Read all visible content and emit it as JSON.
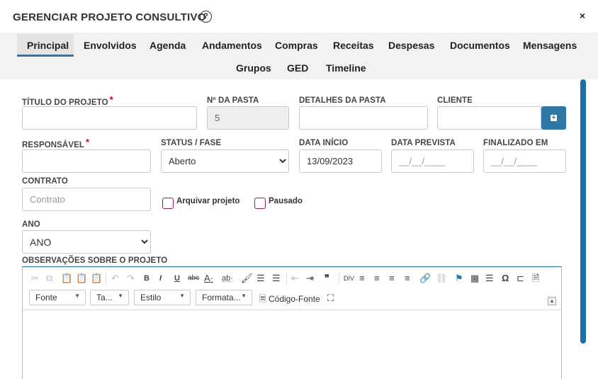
{
  "header": {
    "title": "GERENCIAR PROJETO CONSULTIVO",
    "help_icon": "help-circle-icon",
    "close_label": "×"
  },
  "tabs": [
    {
      "label": "Principal",
      "active": true
    },
    {
      "label": "Envolvidos"
    },
    {
      "label": "Agenda"
    },
    {
      "label": "Andamentos"
    },
    {
      "label": "Compras"
    },
    {
      "label": "Receitas"
    },
    {
      "label": "Despesas"
    },
    {
      "label": "Documentos"
    },
    {
      "label": "Mensagens"
    },
    {
      "label": "Grupos"
    },
    {
      "label": "GED"
    },
    {
      "label": "Timeline"
    }
  ],
  "form": {
    "titulo": {
      "label": "TÍTULO DO PROJETO",
      "required_mark": "*",
      "value": ""
    },
    "n_pasta": {
      "label": "Nº DA PASTA",
      "value": "5"
    },
    "detalhes_pasta": {
      "label": "DETALHES DA PASTA",
      "value": ""
    },
    "cliente": {
      "label": "CLIENTE",
      "value": "",
      "add_icon": "plus-icon"
    },
    "responsavel": {
      "label": "RESPONSÁVEL",
      "required_mark": "*",
      "value": ""
    },
    "status": {
      "label": "STATUS / FASE",
      "selected": "Aberto"
    },
    "data_inicio": {
      "label": "DATA INÍCIO",
      "value": "13/09/2023"
    },
    "data_prevista": {
      "label": "DATA PREVISTA",
      "placeholder": "__/__/____"
    },
    "finalizado_em": {
      "label": "FINALIZADO EM",
      "placeholder": "__/__/____"
    },
    "contrato": {
      "label": "CONTRATO",
      "placeholder": "Contrato"
    },
    "arquivar": {
      "label": "Arquivar projeto",
      "checked": false
    },
    "pausado": {
      "label": "Pausado",
      "checked": false
    },
    "ano": {
      "label": "ANO",
      "selected": "ANO"
    },
    "observacoes": {
      "label": "OBSERVAÇÕES SOBRE O PROJETO"
    }
  },
  "editor": {
    "combos": [
      {
        "label": "Fonte"
      },
      {
        "label": "Ta..."
      },
      {
        "label": "Estilo"
      },
      {
        "label": "Formata..."
      }
    ],
    "source_label": "Código-Fonte",
    "accent_color": "#2f78a6"
  }
}
